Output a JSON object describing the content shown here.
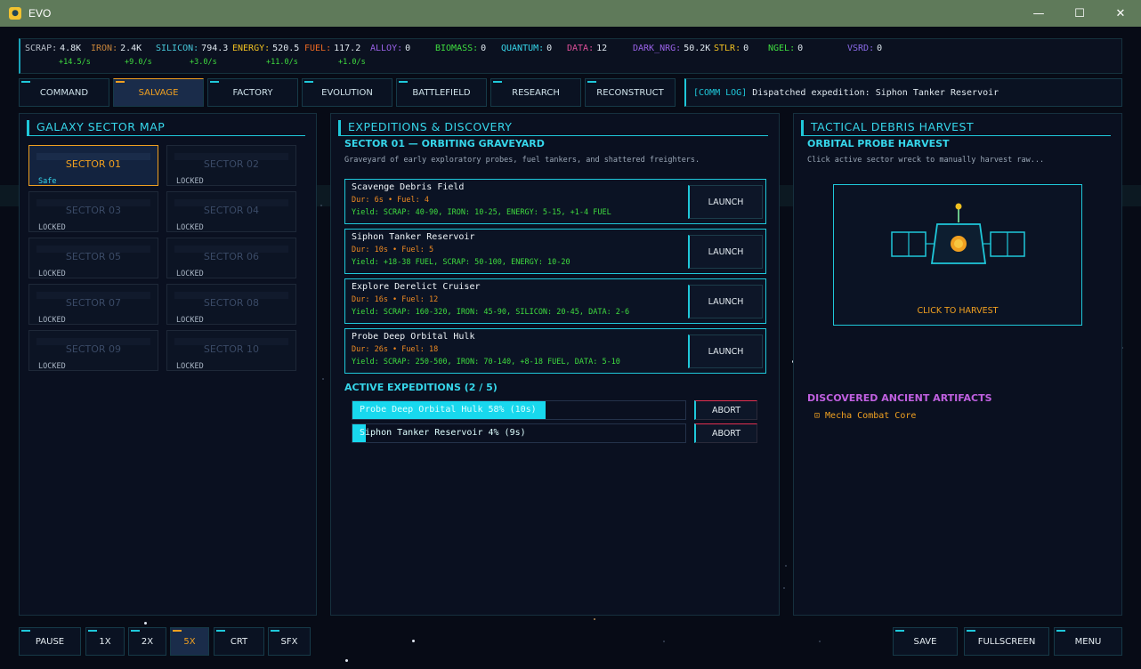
{
  "window": {
    "title": "EVO",
    "minimize": "—",
    "maximize": "☐",
    "close": "✕"
  },
  "resources": [
    {
      "label": "SCRAP:",
      "value": "4.8K",
      "rate": "+14.5/s",
      "color": "#b5bcc6"
    },
    {
      "label": "IRON:",
      "value": "2.4K",
      "rate": "+9.0/s",
      "color": "#c8853a"
    },
    {
      "label": "SILICON:",
      "value": "794.3",
      "rate": "+3.0/s",
      "color": "#46c6d8"
    },
    {
      "label": "ENERGY:",
      "value": "520.5",
      "rate": "+11.0/s",
      "color": "#f0c020"
    },
    {
      "label": "FUEL:",
      "value": "117.2",
      "rate": "+1.0/s",
      "color": "#ee6a22"
    },
    {
      "label": "ALLOY:",
      "value": "0",
      "rate": "",
      "color": "#9a62e8"
    },
    {
      "label": "BIOMASS:",
      "value": "0",
      "rate": "",
      "color": "#3fdc3f"
    },
    {
      "label": "QUANTUM:",
      "value": "0",
      "rate": "",
      "color": "#36d6ea"
    },
    {
      "label": "DATA:",
      "value": "12",
      "rate": "",
      "color": "#e0509a"
    },
    {
      "label": "DARK_NRG:",
      "value": "50.2K",
      "rate": "",
      "color": "#9a62e8"
    },
    {
      "label": "STLR:",
      "value": "0",
      "rate": "",
      "color": "#f0c020"
    },
    {
      "label": "NGEL:",
      "value": "0",
      "rate": "",
      "color": "#3fdc3f"
    },
    {
      "label": "VSRD:",
      "value": "0",
      "rate": "",
      "color": "#8a6ae8"
    }
  ],
  "tabs": [
    "COMMAND",
    "SALVAGE",
    "FACTORY",
    "EVOLUTION",
    "BATTLEFIELD",
    "RESEARCH",
    "RECONSTRUCT"
  ],
  "active_tab": "SALVAGE",
  "comm_log": {
    "tag": "[COMM LOG]",
    "message": "Dispatched expedition: Siphon Tanker Reservoir"
  },
  "sector_map": {
    "title": "GALAXY SECTOR MAP",
    "sectors": [
      {
        "name": "SECTOR 01",
        "status": "Safe"
      },
      {
        "name": "SECTOR 02",
        "status": "LOCKED"
      },
      {
        "name": "SECTOR 03",
        "status": "LOCKED"
      },
      {
        "name": "SECTOR 04",
        "status": "LOCKED"
      },
      {
        "name": "SECTOR 05",
        "status": "LOCKED"
      },
      {
        "name": "SECTOR 06",
        "status": "LOCKED"
      },
      {
        "name": "SECTOR 07",
        "status": "LOCKED"
      },
      {
        "name": "SECTOR 08",
        "status": "LOCKED"
      },
      {
        "name": "SECTOR 09",
        "status": "LOCKED"
      },
      {
        "name": "SECTOR 10",
        "status": "LOCKED"
      }
    ]
  },
  "expeditions": {
    "title": "EXPEDITIONS & DISCOVERY",
    "sector_heading": "SECTOR 01 — ORBITING GRAVEYARD",
    "sector_desc": "Graveyard of early exploratory probes, fuel tankers, and shattered freighters.",
    "launch_label": "LAUNCH",
    "missions": [
      {
        "name": "Scavenge Debris Field",
        "duration": "Dur: 6s  •  Fuel: 4",
        "yield": "Yield: SCRAP: 40-90, IRON: 10-25, ENERGY: 5-15, +1-4 FUEL"
      },
      {
        "name": "Siphon Tanker Reservoir",
        "duration": "Dur: 10s  •  Fuel: 5",
        "yield": "Yield: +18-38 FUEL, SCRAP: 50-100, ENERGY: 10-20"
      },
      {
        "name": "Explore Derelict Cruiser",
        "duration": "Dur: 16s  •  Fuel: 12",
        "yield": "Yield: SCRAP: 160-320, IRON: 45-90, SILICON: 20-45, DATA: 2-6"
      },
      {
        "name": "Probe Deep Orbital Hulk",
        "duration": "Dur: 26s  •  Fuel: 18",
        "yield": "Yield: SCRAP: 250-500, IRON: 70-140, +8-18 FUEL, DATA: 5-10"
      }
    ],
    "active_heading": "ACTIVE EXPEDITIONS (2 / 5)",
    "abort_label": "ABORT",
    "active": [
      {
        "text": "Probe Deep Orbital Hulk 58% (10s)",
        "progress": 0.58
      },
      {
        "text": "Siphon Tanker Reservoir 4% (9s)",
        "progress": 0.04
      }
    ]
  },
  "harvest": {
    "title": "TACTICAL DEBRIS HARVEST",
    "subtitle": "ORBITAL PROBE HARVEST",
    "desc": "Click active sector wreck to manually harvest raw...",
    "cta": "CLICK TO HARVEST",
    "artifacts_heading": "DISCOVERED ANCIENT ARTIFACTS",
    "artifacts": [
      "⊡ Mecha Combat Core"
    ]
  },
  "bottom_left": [
    "PAUSE",
    "1X",
    "2X",
    "5X",
    "CRT",
    "SFX"
  ],
  "bottom_left_active": "5X",
  "bottom_right": [
    "SAVE",
    "FULLSCREEN",
    "MENU"
  ]
}
